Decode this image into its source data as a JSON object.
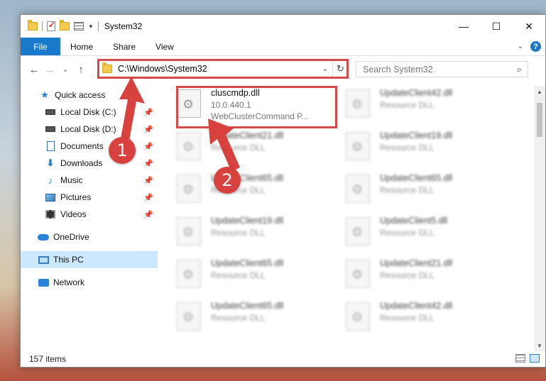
{
  "window": {
    "title": "System32",
    "controls": {
      "minimize": "—",
      "maximize": "☐",
      "close": "✕"
    }
  },
  "ribbon": {
    "tabs": [
      "File",
      "Home",
      "Share",
      "View"
    ],
    "help": "?",
    "collapse_glyph": "⌄"
  },
  "nav": {
    "back": "←",
    "forward": "→",
    "recent": "⌄",
    "up": "↑",
    "address": "C:\\Windows\\System32",
    "address_drop": "⌄",
    "refresh": "↻",
    "search_placeholder": "Search System32",
    "search_icon": "⌕"
  },
  "sidebar": {
    "items": [
      {
        "label": "Quick access",
        "icon": "star-icon"
      },
      {
        "label": "Local Disk (C:)",
        "icon": "disk-icon",
        "pinned": true
      },
      {
        "label": "Local Disk (D:)",
        "icon": "disk-icon",
        "pinned": true
      },
      {
        "label": "Documents",
        "icon": "documents-icon",
        "pinned": true
      },
      {
        "label": "Downloads",
        "icon": "download-icon",
        "pinned": true
      },
      {
        "label": "Music",
        "icon": "music-icon",
        "pinned": true
      },
      {
        "label": "Pictures",
        "icon": "pictures-icon",
        "pinned": true
      },
      {
        "label": "Videos",
        "icon": "videos-icon",
        "pinned": true
      },
      {
        "label": "OneDrive",
        "icon": "cloud-icon"
      },
      {
        "label": "This PC",
        "icon": "pc-icon",
        "selected": true
      },
      {
        "label": "Network",
        "icon": "network-icon"
      }
    ],
    "pin_glyph": "📌"
  },
  "files": [
    {
      "name": "cluscmdp.dll",
      "version": "10.0.440.1",
      "description": "WebClusterCommand P...",
      "highlight": true
    },
    {
      "name": "UpdateClient42.dll",
      "type": "Resource DLL"
    },
    {
      "name": "UpdateClient21.dll",
      "type": "Resource DLL"
    },
    {
      "name": "UpdateClient19.dll",
      "type": "Resource DLL"
    },
    {
      "name": "UpdateClient65.dll",
      "type": "Resource DLL"
    },
    {
      "name": "UpdateClient65.dll",
      "type": "Resource DLL"
    },
    {
      "name": "UpdateClient19.dll",
      "type": "Resource DLL"
    },
    {
      "name": "UpdateClient5.dll",
      "type": "Resource DLL"
    },
    {
      "name": "UpdateClient65.dll",
      "type": "Resource DLL"
    },
    {
      "name": "UpdateClient21.dll",
      "type": "Resource DLL"
    },
    {
      "name": "UpdateClient65.dll",
      "type": "Resource DLL"
    },
    {
      "name": "UpdateClient42.dll",
      "type": "Resource DLL"
    }
  ],
  "status": {
    "count": "157 items"
  },
  "callouts": [
    "1",
    "2"
  ],
  "colors": {
    "accent": "#1979ca",
    "highlight": "#d74a4a",
    "selected": "#cce8ff"
  }
}
